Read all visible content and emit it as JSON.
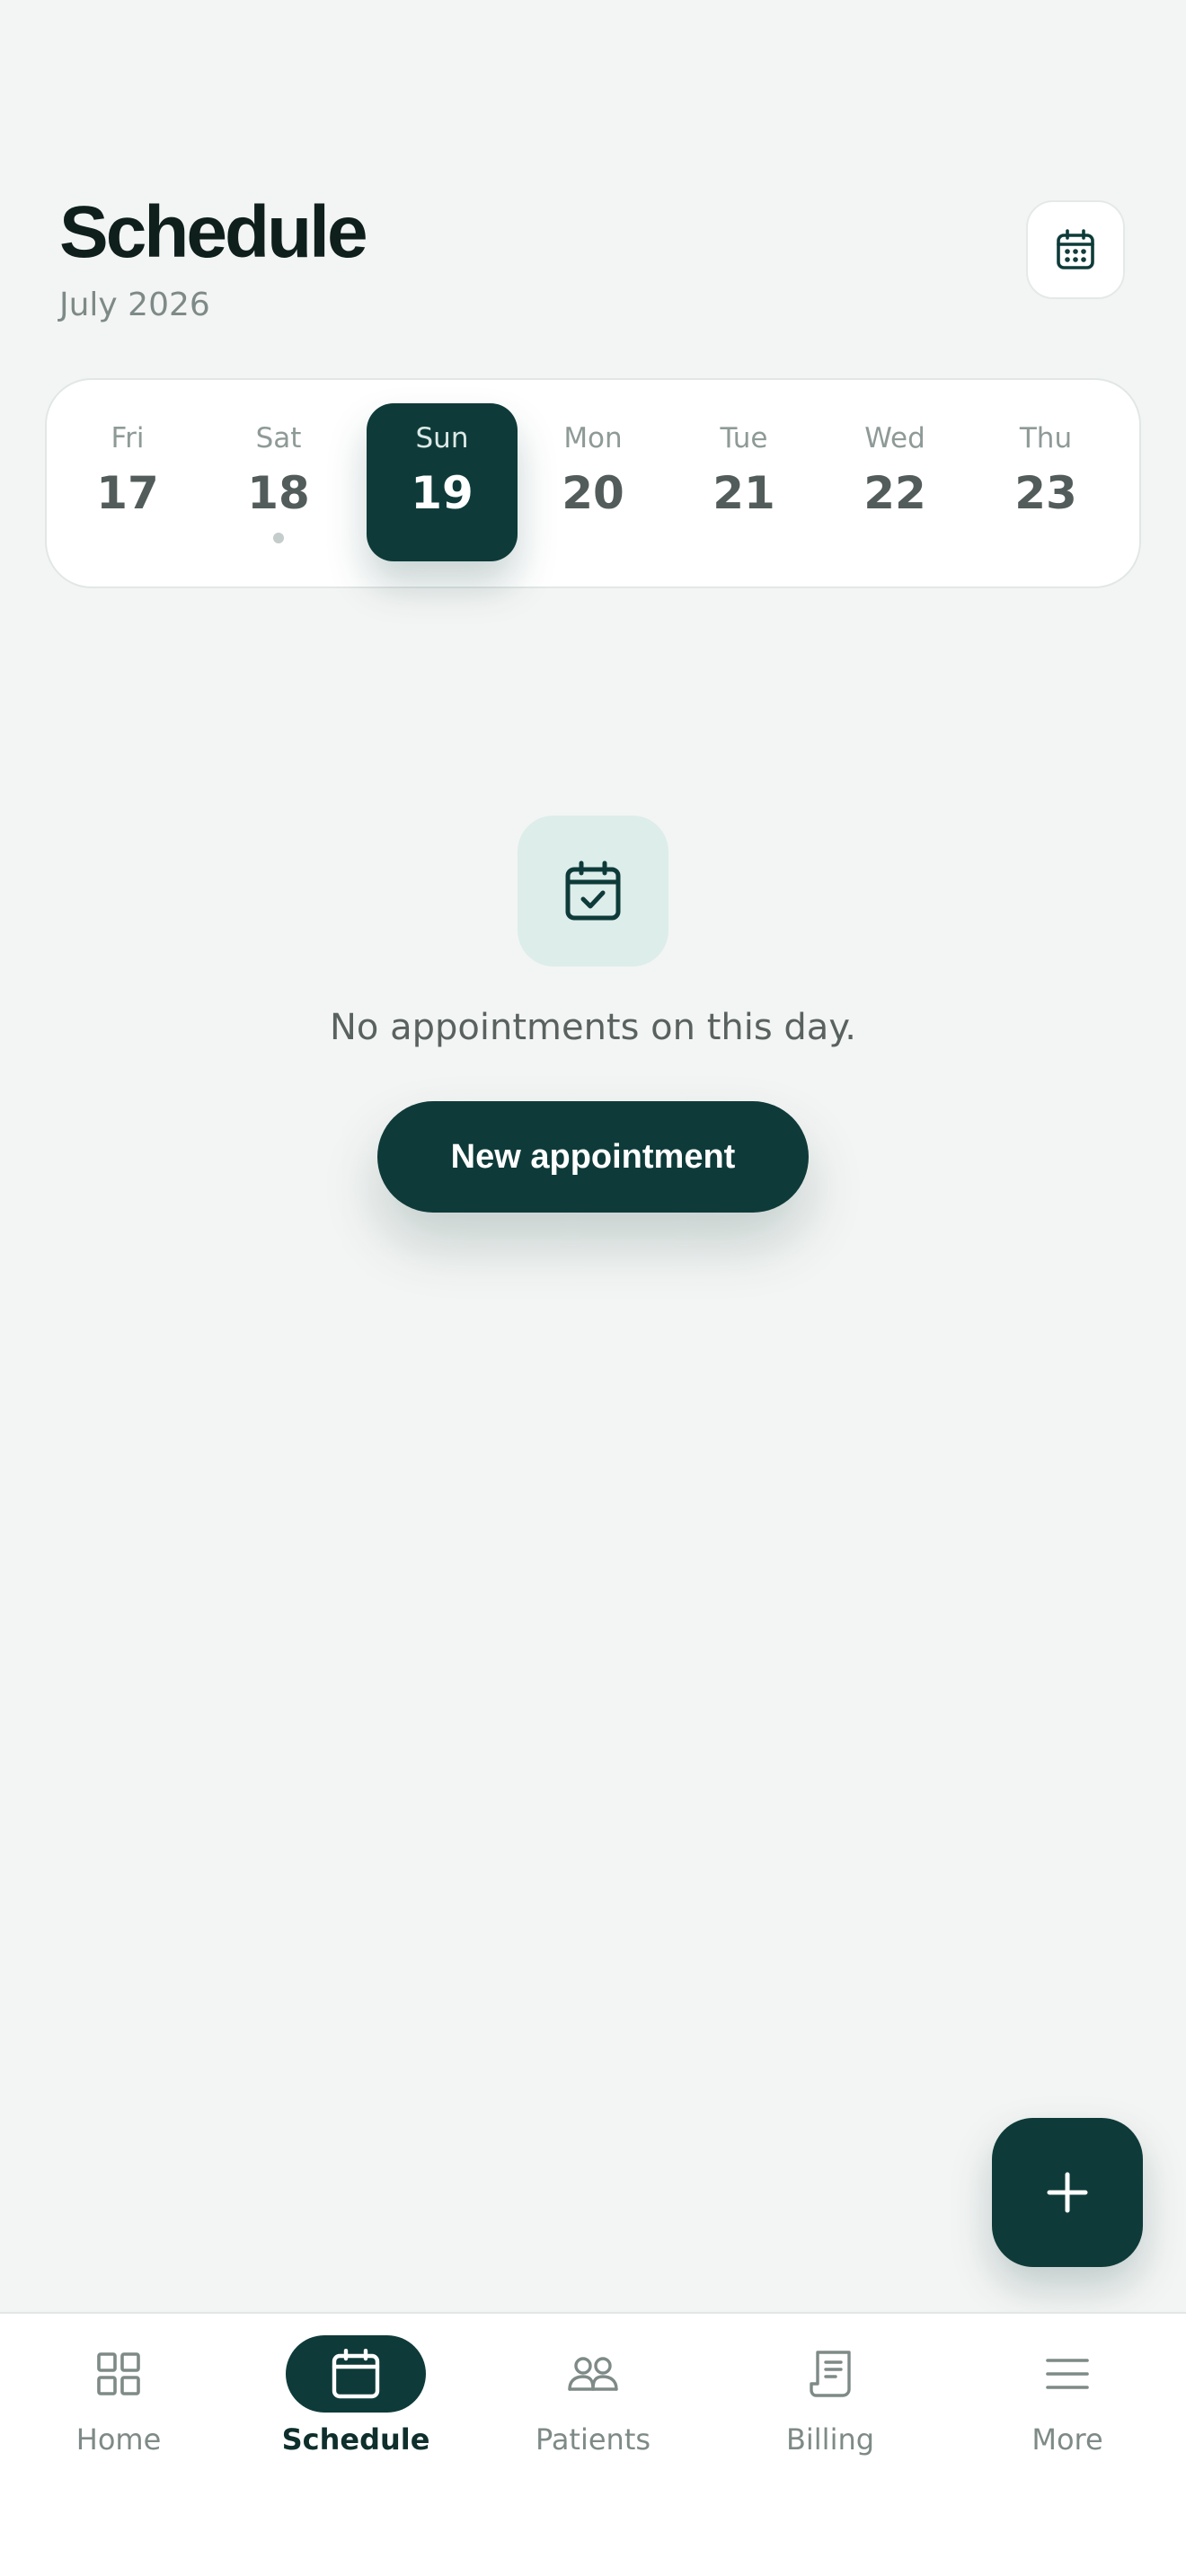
{
  "header": {
    "title": "Schedule",
    "subtitle": "July 2026"
  },
  "week": {
    "days": [
      {
        "name": "Fri",
        "date": "17"
      },
      {
        "name": "Sat",
        "date": "18"
      },
      {
        "name": "Sun",
        "date": "19"
      },
      {
        "name": "Mon",
        "date": "20"
      },
      {
        "name": "Tue",
        "date": "21"
      },
      {
        "name": "Wed",
        "date": "22"
      },
      {
        "name": "Thu",
        "date": "23"
      }
    ]
  },
  "empty_state": {
    "message": "No appointments on this day.",
    "button_label": "New appointment"
  },
  "tabbar": {
    "tabs": [
      {
        "label": "Home",
        "icon": "grid-icon"
      },
      {
        "label": "Schedule",
        "icon": "calendar-icon"
      },
      {
        "label": "Patients",
        "icon": "users-icon"
      },
      {
        "label": "Billing",
        "icon": "receipt-icon"
      },
      {
        "label": "More",
        "icon": "menu-icon"
      }
    ]
  },
  "colors": {
    "primary": "#0E3B39",
    "background": "#F3F5F4",
    "accent_light": "#DDEDEA",
    "muted_text": "#7E8A87"
  }
}
